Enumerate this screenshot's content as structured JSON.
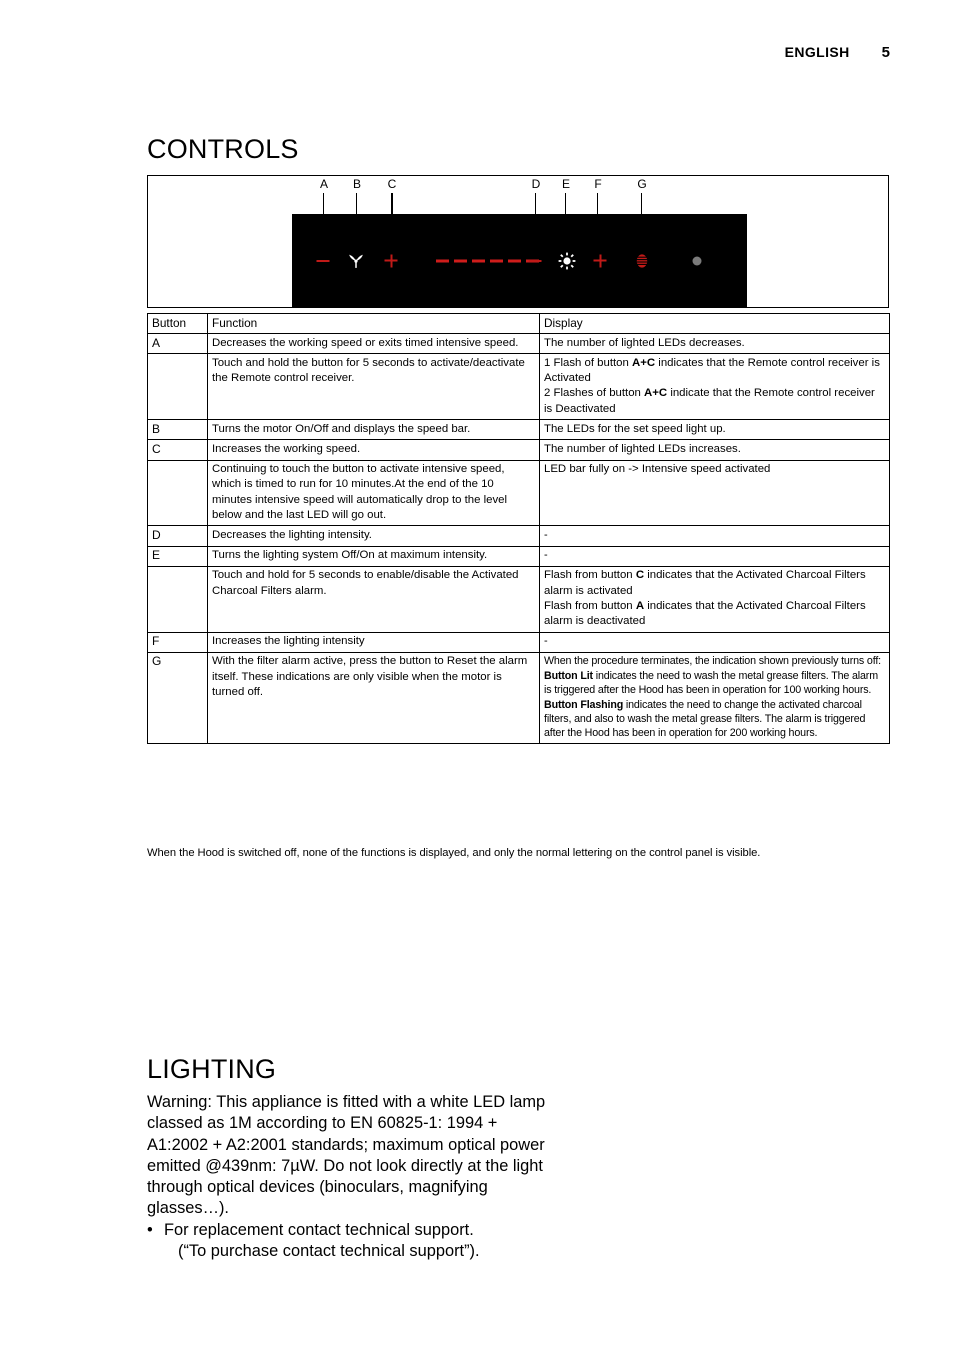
{
  "header": {
    "language": "ENGLISH",
    "page_number": "5"
  },
  "controls": {
    "title": "CONTROLS",
    "diagram": {
      "pointer_labels": [
        "A",
        "B",
        "C",
        "D",
        "E",
        "F",
        "G"
      ],
      "panel_icons": [
        {
          "name": "minus-icon",
          "color": "#c01a18"
        },
        {
          "name": "fan-icon",
          "color": "#ffffff"
        },
        {
          "name": "plus-icon",
          "color": "#c01a18"
        },
        {
          "name": "led-speed-bar",
          "color": "#cf1d1b",
          "segments": 6
        },
        {
          "name": "minus-icon",
          "color": "#c01a18"
        },
        {
          "name": "light-icon",
          "color": "#ffffff"
        },
        {
          "name": "plus-icon",
          "color": "#c01a18"
        },
        {
          "name": "filter-alarm-icon",
          "color": "#c01a18"
        },
        {
          "name": "indicator-dot-icon",
          "color": "#7b7b7b"
        }
      ],
      "panel_background": "#000000"
    },
    "table": {
      "headers": {
        "button": "Button",
        "function": "Function",
        "display": "Display"
      },
      "rows": [
        {
          "button": "A",
          "function": "Decreases the working speed or exits timed intensive speed.",
          "display": "The number of lighted LEDs decreases."
        },
        {
          "button": "",
          "function": "Touch and hold the button for 5 seconds to activate/deactivate the Remote control receiver.",
          "display_line1_pre": "1 Flash of button ",
          "display_line1_bold": "A+C",
          "display_line1_post": " indicates that the Remote control receiver is Activated",
          "display_line2_pre": "2 Flashes of button ",
          "display_line2_bold": "A+C",
          "display_line2_post": " indicate that the Remote control receiver is Deactivated"
        },
        {
          "button": "B",
          "function": "Turns the motor On/Off and displays the speed bar.",
          "display": "The LEDs for the set speed light up."
        },
        {
          "button": "C",
          "function": "Increases the working speed.",
          "display": "The number of lighted LEDs increases."
        },
        {
          "button": "",
          "function": "Continuing to touch the button to activate intensive speed, which is timed to run for 10 minutes.At the end of the 10 minutes intensive speed will automatically drop to the level below and the last LED will go out.",
          "display": "LED bar fully on -> Intensive speed activated"
        },
        {
          "button": "D",
          "function": "Decreases the lighting intensity.",
          "display": "-"
        },
        {
          "button": "E",
          "function": "Turns the lighting system Off/On at maximum intensity.",
          "display": "-"
        },
        {
          "button": "",
          "function": "Touch and hold for 5 seconds to enable/disable the Activated Charcoal Filters alarm.",
          "display_line1_pre": "Flash from button ",
          "display_line1_bold": "C",
          "display_line1_post": " indicates that the Activated Charcoal Filters alarm is activated",
          "display_line2_pre": "Flash from button ",
          "display_line2_bold": "A",
          "display_line2_post": " indicates that the Activated Charcoal Filters alarm is deactivated"
        },
        {
          "button": "F",
          "function": "Increases the lighting intensity",
          "display": "-"
        },
        {
          "button": "G",
          "function": "With the filter alarm active, press the button to Reset the alarm itself. These indications are only visible when the motor is turned off.",
          "display_intro": "When the procedure terminates, the indication shown previously turns off:",
          "display_line1_bold": "Button Lit",
          "display_line1_post": " indicates the need to wash the metal grease filters. The alarm is triggered after the Hood has been in operation for 100 working hours.",
          "display_line2_bold": "Button Flashing",
          "display_line2_post": " indicates the need to change the activated charcoal filters, and also to wash the metal grease filters. The alarm is triggered after the Hood has been in operation for 200 working hours."
        }
      ]
    },
    "note": "When the Hood is switched off, none of the functions is displayed, and only the normal lettering on the control panel is visible."
  },
  "lighting": {
    "title": "LIGHTING",
    "warning": "Warning: This appliance is fitted with a white LED lamp classed as 1M according to EN 60825-1: 1994 + A1:2002 + A2:2001 standards; maximum optical power emitted @439nm: 7µW. Do not look directly at the light through optical devices (binoculars, magnifying glasses…).",
    "bullet_mark": "•",
    "bullet_text": "For replacement contact technical support.",
    "bullet_subtext": "(“To purchase contact technical support”)."
  }
}
